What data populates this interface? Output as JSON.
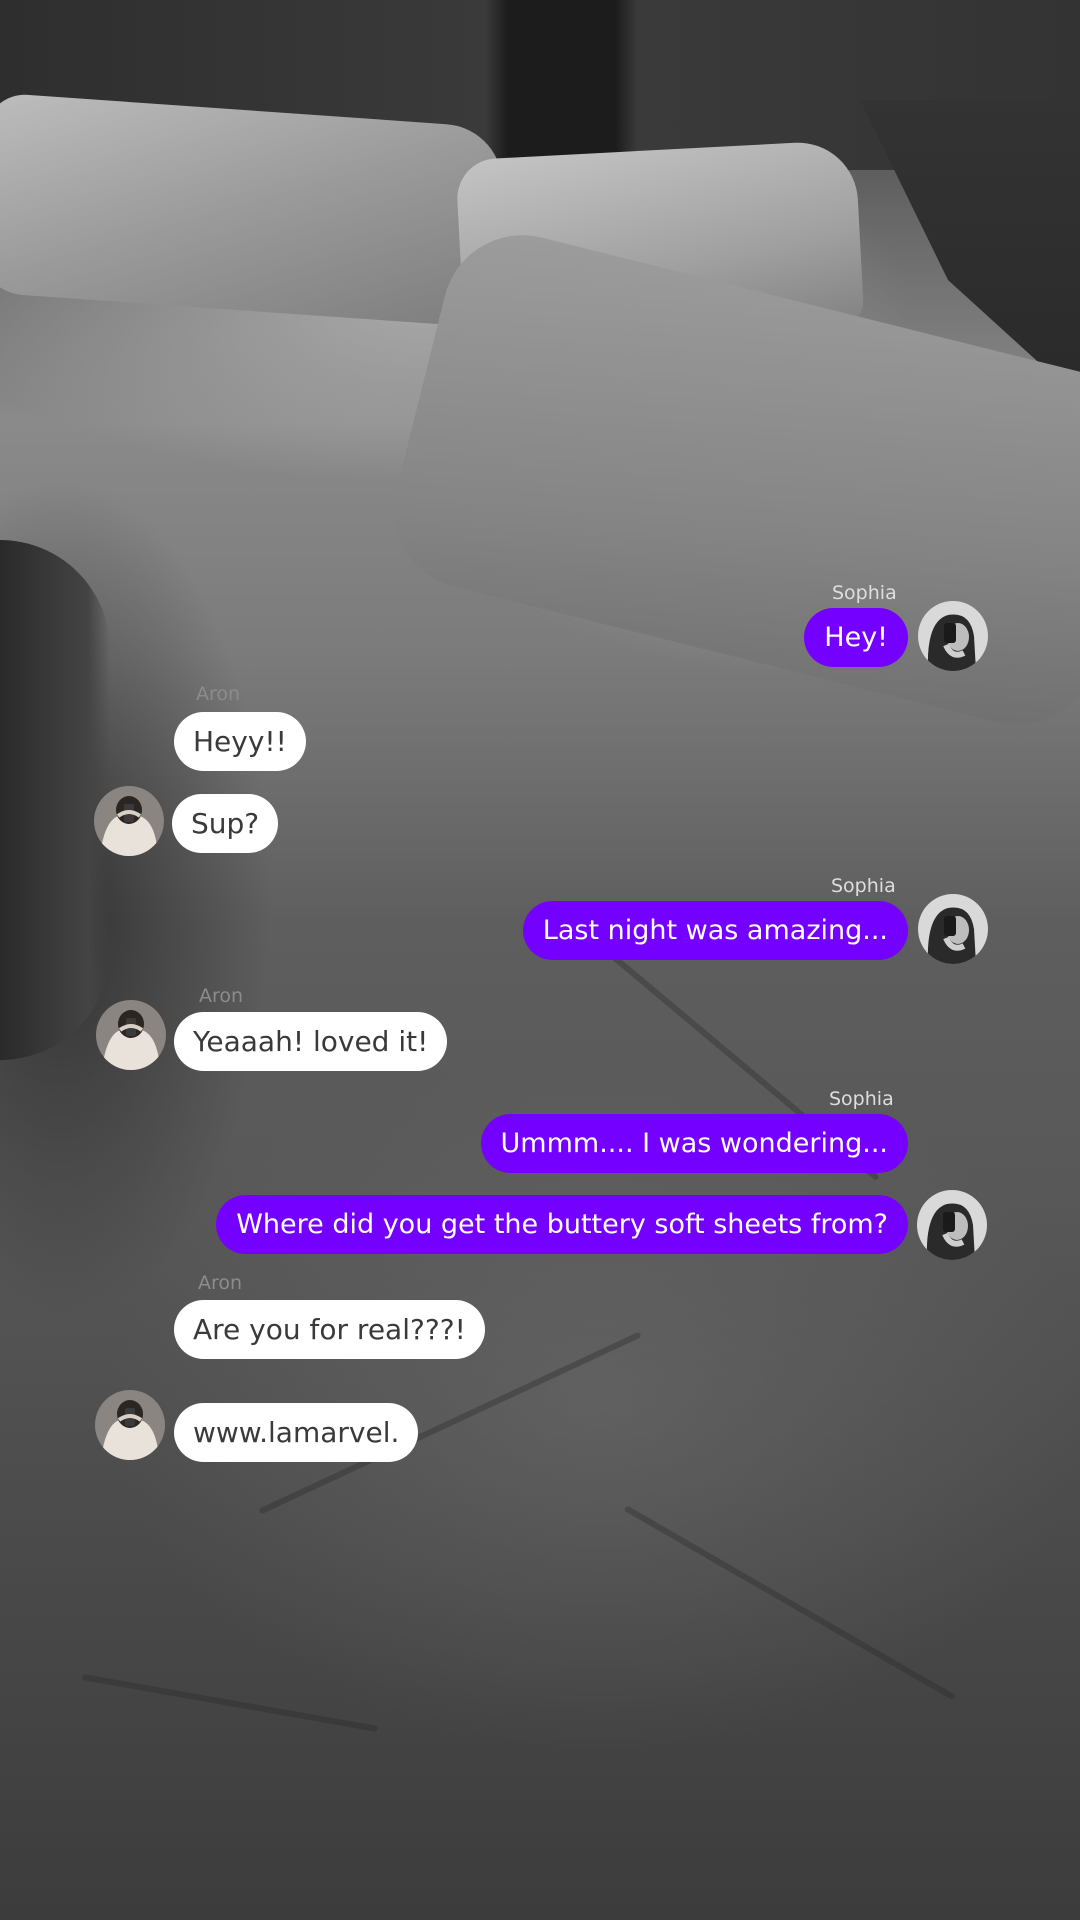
{
  "participants": {
    "sophia": "Sophia",
    "aron": "Aron"
  },
  "messages": [
    {
      "sender": "Sophia",
      "text": "Hey!"
    },
    {
      "sender": "Aron",
      "text": "Heyy!!"
    },
    {
      "sender": "Aron",
      "text": "Sup?"
    },
    {
      "sender": "Sophia",
      "text": "Last night was amazing..."
    },
    {
      "sender": "Aron",
      "text": "Yeaaah! loved it!"
    },
    {
      "sender": "Sophia",
      "text": "Ummm.... I was wondering..."
    },
    {
      "sender": "Sophia",
      "text": "Where did you get the buttery soft sheets from?"
    },
    {
      "sender": "Aron",
      "text": "Are you for real???!"
    },
    {
      "sender": "Aron",
      "text": "www.lamarvel."
    }
  ],
  "colors": {
    "outgoing_bubble": "#7400ff",
    "incoming_bubble": "#ffffff"
  },
  "icons": {
    "sophia_avatar": "sophia-avatar-photo",
    "aron_avatar": "aron-avatar-photo"
  }
}
